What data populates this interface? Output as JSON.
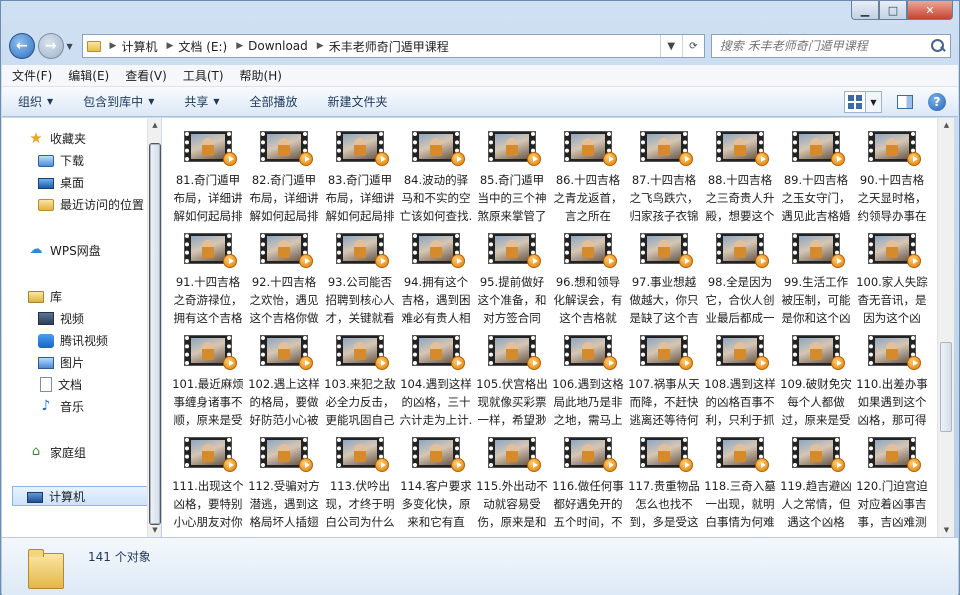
{
  "address": {
    "segments": [
      "计算机",
      "文档 (E:)",
      "Download",
      "禾丰老师奇门遁甲课程"
    ]
  },
  "search": {
    "placeholder": "搜索 禾丰老师奇门遁甲课程"
  },
  "menu": [
    "文件(F)",
    "编辑(E)",
    "查看(V)",
    "工具(T)",
    "帮助(H)"
  ],
  "toolbar": {
    "organize": "组织",
    "include_library": "包含到库中",
    "share": "共享",
    "play_all": "全部播放",
    "new_folder": "新建文件夹"
  },
  "nav": {
    "favorites": "收藏夹",
    "downloads": "下载",
    "desktop": "桌面",
    "recent": "最近访问的位置",
    "wps": "WPS网盘",
    "libraries": "库",
    "videos": "视频",
    "tencent_video": "腾讯视频",
    "pictures": "图片",
    "documents": "文档",
    "music": "音乐",
    "homegroup": "家庭组",
    "computer": "计算机"
  },
  "files": [
    "81.奇门遁甲布局，详细讲解如何起局排盘...",
    "82.奇门遁甲布局，详细讲解如何起局排盘...",
    "83.奇门遁甲布局，详细讲解如何起局排盘...",
    "84.波动的驿马和不实的空亡该如何查找.m...",
    "85.奇门遁甲当中的三个神煞原来掌管了婚...",
    "86.十四吉格之青龙返首，言之所在和“她...",
    "87.十四吉格之飞鸟跌穴，归家孩子衣锦还...",
    "88.十四吉格之三奇贵人升殿，想要这个吉...",
    "89.十四吉格之玉女守门，遇见此吉格婚嫁...",
    "90.十四吉格之天显时格，约领导办事在什...",
    "91.十四吉格之奇游禄位，拥有这个吉格想...",
    "92.十四吉格之欢怡，遇见这个吉格你做成...",
    "93.公司能否招聘到核心人才，关键就看这...",
    "94.拥有这个吉格，遇到困难必有贵人相助...",
    "95.提前做好这个准备，和对方签合同都...",
    "96.想和领导化解误会，有这个吉格就解...",
    "97.事业想越做越大，你只是缺了这个吉格...",
    "98.全是因为它，合伙人创业最后都成一拍...",
    "99.生活工作被压制，可能是你和这个凶格...",
    "100.家人失踪杳无音讯，是因为这个凶格...",
    "101.最近麻烦事缠身诸事不顺，原来是受这...",
    "102.遇上这样的格局，要做好防范小心被偷...",
    "103.来犯之敌必全力反击，更能巩固自己地...",
    "104.遇到这样的凶格，三十六计走为上计.m...",
    "105.伏宫格出现就像买彩票一样，希望渺茫...",
    "106.遇到这格局此地乃是非之地，需马上撤...",
    "107.祸事从天而降，不赶快逃离还等待何时...",
    "108.遇到这样的凶格百事不利，只利于抓捕...",
    "109.破财免灾每个人都做过，原来是受小格...",
    "110.出差办事如果遇到这个凶格，那可得小...",
    "111.出现这个凶格，要特别小心朋友对你不...",
    "112.受骗对方潜逃，遇到这格局坏人插翅难...",
    "113.伏吟出现，才终于明白公司为什么火不...",
    "114.客户要求多变化快，原来和它有直接...",
    "115.外出动不动就容易受伤，原来是和它有...",
    "116.做任何事都好遇免开的五个时间，不可...",
    "117.贵重物品怎么也找不到，多是受这个凶...",
    "118.三奇入墓一出现，就明白事情为何难办...",
    "119.趋吉避凶人之常情，但遇这个凶格难...",
    "120.门迫宫迫对应着凶事吉事，吉凶难测之..."
  ],
  "partial_top": [
    "...",
    "...",
    "...mp...",
    "...",
    "...",
    "...",
    "...",
    "...",
    "...mp...",
    "..."
  ],
  "status": {
    "count": "141 个对象"
  }
}
